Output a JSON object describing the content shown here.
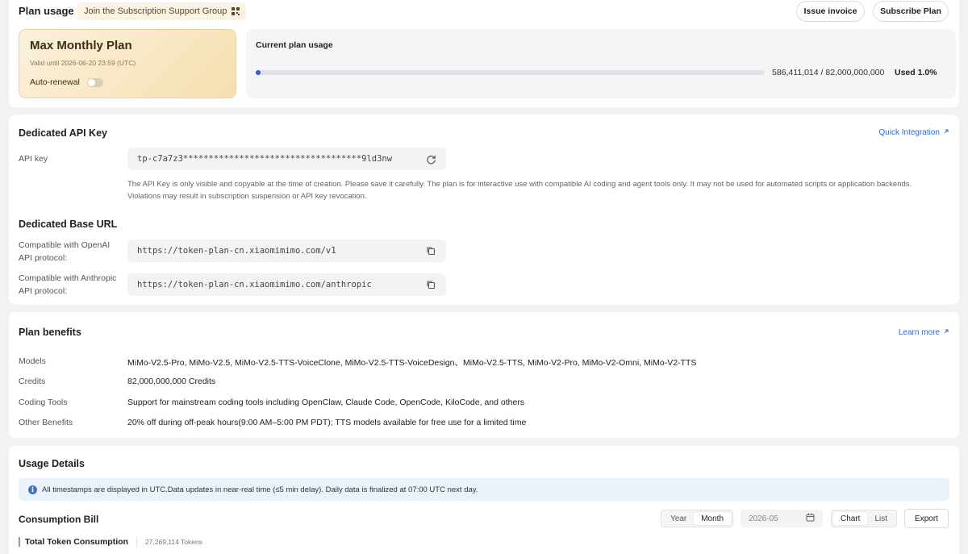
{
  "plan_usage": {
    "title": "Plan usage",
    "support_group": "Join the Subscription Support Group",
    "issue_invoice": "Issue invoice",
    "subscribe_plan": "Subscribe Plan",
    "plan_name": "Max Monthly Plan",
    "valid_until": "Valid until 2026-06-20 23:59 (UTC)",
    "auto_renewal": "Auto-renewal",
    "auto_renewal_on": false,
    "current_usage_label": "Current plan usage",
    "usage_numbers": "586,411,014 / 82,000,000,000",
    "used_percent": "Used 1.0%",
    "used_fraction": 0.01
  },
  "api_key_section": {
    "title": "Dedicated API Key",
    "quick_integration": "Quick Integration",
    "api_key_label": "API key",
    "api_key_value": "tp-c7a7z3***********************************9ld3nw",
    "note": "The API Key is only visible and copyable at the time of creation. Please save it carefully. The plan is for interactive use with compatible AI coding and agent tools only. It may not be used for automated scripts or application backends. Violations may result in subscription suspension or API key revocation.",
    "base_url_title": "Dedicated Base URL",
    "openai_label": "Compatible with OpenAI API protocol:",
    "openai_url": "https://token-plan-cn.xiaomimimo.com/v1",
    "anthropic_label": "Compatible with Anthropic API protocol:",
    "anthropic_url": "https://token-plan-cn.xiaomimimo.com/anthropic"
  },
  "benefits": {
    "title": "Plan benefits",
    "learn_more": "Learn more",
    "rows": [
      {
        "label": "Models",
        "value": "MiMo-V2.5-Pro, MiMo-V2.5, MiMo-V2.5-TTS-VoiceClone, MiMo-V2.5-TTS-VoiceDesign、MiMo-V2.5-TTS, MiMo-V2-Pro, MiMo-V2-Omni, MiMo-V2-TTS"
      },
      {
        "label": "Credits",
        "value": "82,000,000,000 Credits"
      },
      {
        "label": "Coding Tools",
        "value": "Support for mainstream coding tools including OpenClaw, Claude Code, OpenCode, KiloCode, and others"
      },
      {
        "label": "Other Benefits",
        "value": "20% off during off-peak hours(9:00 AM–5:00 PM PDT); TTS models available for free use for a limited time"
      }
    ]
  },
  "usage_details": {
    "title": "Usage Details",
    "info": "All timestamps are displayed in UTC.Data updates in near-real time (≤5 min delay). Daily data is finalized at 07:00 UTC next day.",
    "bill_title": "Consumption Bill",
    "period_year": "Year",
    "period_month": "Month",
    "date_value": "2026-05",
    "view_chart": "Chart",
    "view_list": "List",
    "export": "Export",
    "total_label": "Total Token Consumption",
    "total_value": "27,269,114 Tokens"
  },
  "colors": {
    "accent": "#2a6bd8",
    "progress": "#2a5bd7",
    "plan_card": "#f6dfb0",
    "info_bg": "#eaf3fb"
  }
}
